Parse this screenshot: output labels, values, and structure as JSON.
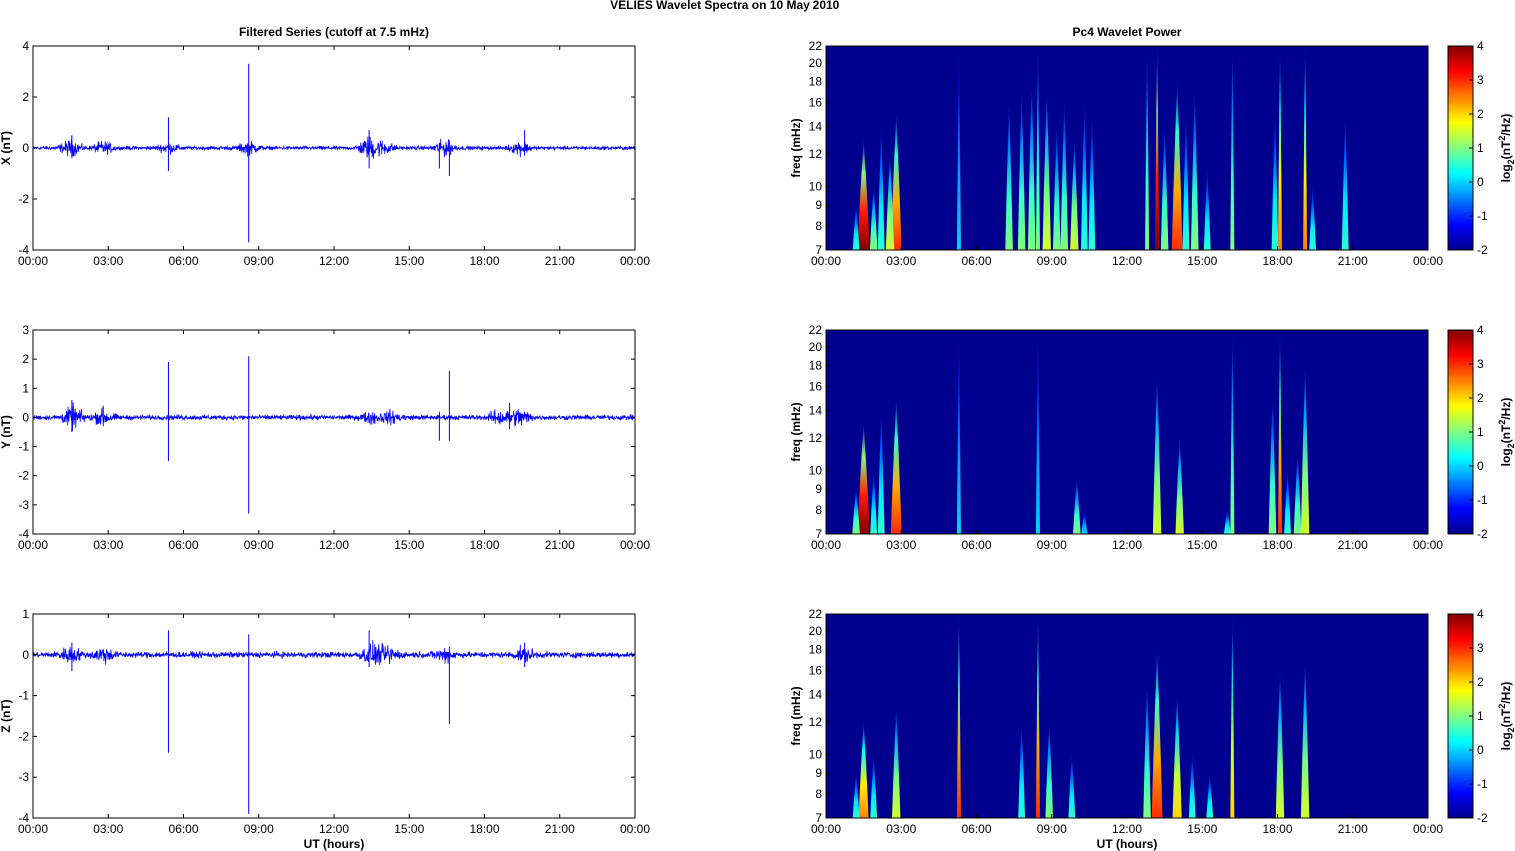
{
  "chart_data": {
    "type": "multi-panel",
    "title": "VELIES Wavelet Spectra on 10 May",
    "year": "2010",
    "left_title": "Filtered Series (cutoff at 7.5 mHz)",
    "right_title": "Pc4 Wavelet Power",
    "xlabel": "UT (hours)",
    "x_ticks": [
      "00:00",
      "03:00",
      "06:00",
      "09:00",
      "12:00",
      "15:00",
      "18:00",
      "21:00",
      "00:00"
    ],
    "xlim_hours": [
      0,
      24
    ],
    "freq_label": "freq (mHz)",
    "freq_ticks": [
      7,
      8,
      9,
      10,
      12,
      14,
      16,
      18,
      20,
      22
    ],
    "freq_lim": [
      7,
      22
    ],
    "colorbar_label": "log2(nT^2/Hz)",
    "colorbar_ticks": [
      4,
      3,
      2,
      1,
      0,
      -1,
      -2
    ],
    "clim": [
      -2,
      4
    ],
    "series": [
      {
        "name": "X",
        "ylabel": "X (nT)",
        "ylim": [
          -4,
          4
        ],
        "y_ticks": [
          4,
          2,
          0,
          -2,
          -4
        ],
        "noise_nT": 0.06,
        "bursts": [
          [
            1.5,
            0.25
          ],
          [
            2.8,
            0.2
          ],
          [
            5.4,
            0.15
          ],
          [
            8.6,
            0.2
          ],
          [
            13.4,
            0.35
          ],
          [
            14,
            0.2
          ],
          [
            16.4,
            0.25
          ],
          [
            19.4,
            0.2
          ]
        ],
        "spikes": [
          [
            1.55,
            0.5,
            -0.4
          ],
          [
            5.4,
            1.2,
            -0.9
          ],
          [
            8.6,
            3.3,
            -3.7
          ],
          [
            13.4,
            0.7,
            -0.8
          ],
          [
            16.2,
            0.2,
            -0.8
          ],
          [
            16.6,
            0.3,
            -1.1
          ],
          [
            19.6,
            0.7,
            -0.3
          ]
        ],
        "wavelet_events": [
          [
            1.5,
            13,
            4
          ],
          [
            1.2,
            9,
            0.5
          ],
          [
            1.9,
            10,
            1
          ],
          [
            2.2,
            14,
            0.5
          ],
          [
            2.8,
            15,
            3
          ],
          [
            2.55,
            12,
            1.5
          ],
          [
            5.3,
            22,
            0
          ],
          [
            7.3,
            16,
            1
          ],
          [
            7.8,
            17,
            1
          ],
          [
            8.2,
            18,
            1
          ],
          [
            8.45,
            22,
            1
          ],
          [
            8.8,
            17,
            1.5
          ],
          [
            9.2,
            14,
            1
          ],
          [
            9.5,
            16,
            1
          ],
          [
            9.9,
            13,
            1.5
          ],
          [
            10.3,
            16,
            0.5
          ],
          [
            10.6,
            15,
            0.5
          ],
          [
            12.8,
            22,
            1
          ],
          [
            13.2,
            22,
            4
          ],
          [
            13.5,
            14,
            1
          ],
          [
            14.0,
            18,
            3
          ],
          [
            14.35,
            15,
            0.5
          ],
          [
            14.7,
            17,
            1
          ],
          [
            15.2,
            11,
            0.5
          ],
          [
            16.2,
            22,
            1
          ],
          [
            18.1,
            22,
            2.5
          ],
          [
            17.9,
            15,
            0.5
          ],
          [
            19.1,
            22,
            2.5
          ],
          [
            19.4,
            10,
            0.5
          ],
          [
            20.7,
            15,
            0.5
          ]
        ]
      },
      {
        "name": "Y",
        "ylabel": "Y (nT)",
        "ylim": [
          -4,
          3
        ],
        "y_ticks": [
          3,
          2,
          1,
          0,
          -1,
          -2,
          -3,
          -4
        ],
        "noise_nT": 0.07,
        "bursts": [
          [
            1.6,
            0.3
          ],
          [
            2.8,
            0.2
          ],
          [
            13.5,
            0.15
          ],
          [
            14.3,
            0.15
          ],
          [
            18.6,
            0.2
          ],
          [
            19.4,
            0.25
          ]
        ],
        "spikes": [
          [
            1.55,
            0.6,
            -0.5
          ],
          [
            2.8,
            0.4,
            -0.3
          ],
          [
            5.4,
            1.9,
            -1.5
          ],
          [
            8.6,
            2.1,
            -3.3
          ],
          [
            16.2,
            0.2,
            -0.8
          ],
          [
            16.6,
            1.6,
            -0.8
          ],
          [
            19.0,
            0.5,
            -0.4
          ]
        ],
        "wavelet_events": [
          [
            1.5,
            13,
            4
          ],
          [
            1.2,
            9,
            1
          ],
          [
            1.9,
            10,
            0.5
          ],
          [
            2.2,
            14,
            0.5
          ],
          [
            2.8,
            15,
            3
          ],
          [
            5.3,
            22,
            0
          ],
          [
            8.45,
            22,
            0
          ],
          [
            10.0,
            9.5,
            1
          ],
          [
            10.3,
            8,
            0
          ],
          [
            13.2,
            17,
            1.5
          ],
          [
            14.1,
            12,
            1.5
          ],
          [
            16.2,
            22,
            1
          ],
          [
            16.0,
            8,
            0.5
          ],
          [
            17.8,
            15,
            1
          ],
          [
            18.1,
            22,
            3
          ],
          [
            18.4,
            10,
            0.5
          ],
          [
            18.8,
            11,
            1
          ],
          [
            19.1,
            18,
            1.5
          ]
        ]
      },
      {
        "name": "Z",
        "ylabel": "Z (nT)",
        "ylim": [
          -4,
          1
        ],
        "y_ticks": [
          1,
          0,
          -1,
          -2,
          -3,
          -4
        ],
        "noise_nT": 0.06,
        "bursts": [
          [
            1.5,
            0.15
          ],
          [
            2.8,
            0.15
          ],
          [
            13.5,
            0.2
          ],
          [
            14.2,
            0.15
          ],
          [
            16.4,
            0.12
          ],
          [
            19.6,
            0.12
          ]
        ],
        "spikes": [
          [
            1.55,
            0.3,
            -0.4
          ],
          [
            5.4,
            0.6,
            -2.4
          ],
          [
            8.6,
            0.5,
            -3.9
          ],
          [
            13.4,
            0.6,
            -0.3
          ],
          [
            16.6,
            0.2,
            -1.7
          ],
          [
            19.6,
            0.3,
            -0.3
          ]
        ],
        "wavelet_events": [
          [
            1.5,
            12,
            2.5
          ],
          [
            1.2,
            9,
            0.5
          ],
          [
            1.9,
            10,
            0.5
          ],
          [
            2.8,
            13,
            1.5
          ],
          [
            5.3,
            22,
            3
          ],
          [
            8.45,
            22,
            3
          ],
          [
            7.8,
            12,
            0.5
          ],
          [
            8.9,
            12,
            1
          ],
          [
            9.8,
            10,
            0.5
          ],
          [
            12.8,
            15,
            1
          ],
          [
            13.2,
            18,
            3
          ],
          [
            14.0,
            14,
            2
          ],
          [
            14.6,
            10,
            0.5
          ],
          [
            15.3,
            9,
            0.5
          ],
          [
            16.2,
            22,
            2
          ],
          [
            18.1,
            16,
            1.5
          ],
          [
            19.1,
            17,
            1.5
          ]
        ]
      }
    ]
  }
}
